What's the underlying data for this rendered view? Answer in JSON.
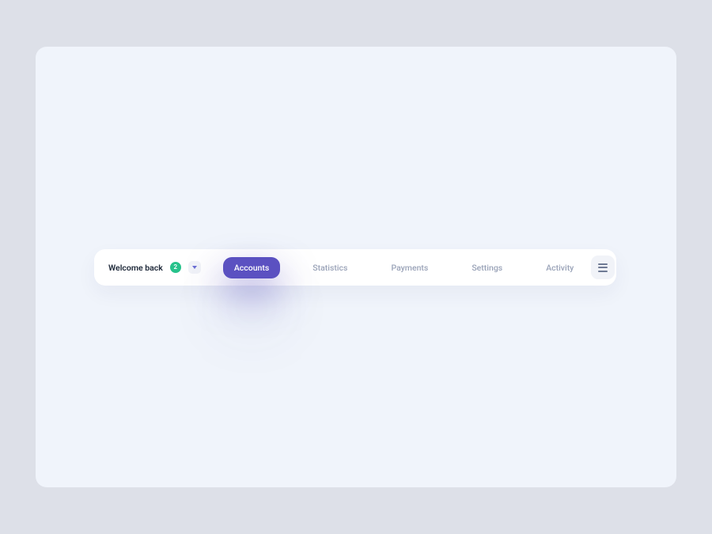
{
  "welcome": {
    "text": "Welcome back",
    "badge": "2"
  },
  "tabs": {
    "accounts": "Accounts",
    "statistics": "Statistics",
    "payments": "Payments",
    "settings": "Settings",
    "activity": "Activity"
  }
}
